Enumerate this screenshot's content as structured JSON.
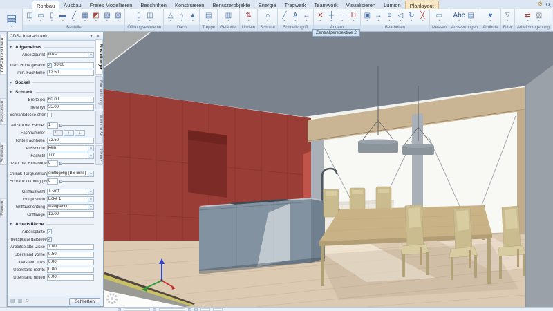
{
  "ribbon": {
    "tabs": [
      {
        "label": "Rohbau",
        "active": true
      },
      {
        "label": "Ausbau"
      },
      {
        "label": "Freies Modellieren"
      },
      {
        "label": "Beschriften"
      },
      {
        "label": "Konstruieren"
      },
      {
        "label": "Benutzerobjekte"
      },
      {
        "label": "Energie"
      },
      {
        "label": "Tragwerk"
      },
      {
        "label": "Teamwork"
      },
      {
        "label": "Visualisieren"
      },
      {
        "label": "Lumion"
      },
      {
        "label": "Planlayout",
        "highlight": true
      }
    ],
    "groups": [
      {
        "label": "Bauteile",
        "icons": [
          {
            "name": "wall-icon",
            "glyph": "◫"
          },
          {
            "name": "ceiling-icon",
            "glyph": "▭"
          },
          {
            "name": "column-icon",
            "glyph": "▯"
          },
          {
            "name": "beam-icon",
            "glyph": "▬"
          },
          {
            "name": "profile-icon",
            "glyph": "╱"
          },
          {
            "name": "mesh-icon",
            "glyph": "▦"
          },
          {
            "name": "import-icon",
            "glyph": "◩",
            "color": "#a8433a"
          },
          {
            "name": "snap-icon",
            "glyph": "▧"
          },
          {
            "name": "tools-icon",
            "glyph": "▨"
          }
        ]
      },
      {
        "label": "Öffnungselemente",
        "icons": [
          {
            "name": "door-icon",
            "glyph": "▯"
          },
          {
            "name": "window-icon",
            "glyph": "◫"
          }
        ]
      },
      {
        "label": "Dach",
        "icons": [
          {
            "name": "roof-icon",
            "glyph": "△"
          },
          {
            "name": "dormer-icon",
            "glyph": "⌂"
          },
          {
            "name": "skylight-icon",
            "glyph": "▲"
          }
        ]
      },
      {
        "label": "Treppe",
        "icons": [
          {
            "name": "stair-icon",
            "glyph": "▤"
          }
        ]
      },
      {
        "label": "Geländer",
        "icons": [
          {
            "name": "railing-icon",
            "glyph": "▥"
          }
        ]
      },
      {
        "label": "Update",
        "icons": [
          {
            "name": "update-icon",
            "glyph": "⇅",
            "color": "#a8433a"
          }
        ]
      },
      {
        "label": "Schnitte",
        "icons": [
          {
            "name": "section-icon",
            "glyph": "∩"
          }
        ]
      },
      {
        "label": "Schnellzugriff",
        "icons": [
          {
            "name": "line-icon",
            "glyph": "╱"
          },
          {
            "name": "text-icon",
            "glyph": "A"
          },
          {
            "name": "dimension-icon",
            "glyph": "↔"
          }
        ]
      },
      {
        "label": "Ändern",
        "icons": [
          {
            "name": "erase-icon",
            "glyph": "✕",
            "color": "#a8433a"
          },
          {
            "name": "divide-icon",
            "glyph": "┼"
          },
          {
            "name": "polyline-icon",
            "glyph": "~"
          },
          {
            "name": "join-icon",
            "glyph": "H",
            "color": "#a8433a"
          }
        ]
      },
      {
        "label": "Bearbeiten",
        "icons": [
          {
            "name": "copy-icon",
            "glyph": "▣"
          },
          {
            "name": "move-icon",
            "glyph": "↔"
          },
          {
            "name": "align-icon",
            "glyph": "≡"
          },
          {
            "name": "mirror-icon",
            "glyph": "◁"
          },
          {
            "name": "rotate-icon",
            "glyph": "↻"
          },
          {
            "name": "stretch-icon",
            "glyph": "╳",
            "color": "#a8433a"
          }
        ]
      },
      {
        "label": "Messen",
        "icons": [
          {
            "name": "measure-icon",
            "glyph": "▭"
          }
        ]
      },
      {
        "label": "Auswertungen",
        "icons": [
          {
            "name": "report-icon",
            "glyph": "Abc",
            "color": "#2f4f7f"
          },
          {
            "name": "list-icon",
            "glyph": "▤"
          }
        ]
      },
      {
        "label": "Attribute",
        "icons": [
          {
            "name": "attributes-icon",
            "glyph": "♥",
            "color": "#3f6fb5"
          }
        ]
      },
      {
        "label": "Filter",
        "icons": [
          {
            "name": "filter-icon",
            "glyph": "∇",
            "color": "#8a97a6"
          }
        ]
      },
      {
        "label": "Arbeitsumgebung",
        "icons": [
          {
            "name": "workspace-icon",
            "glyph": "⇄",
            "color": "#a8433a"
          },
          {
            "name": "layout-icon",
            "glyph": "▧",
            "color": "#7c8795"
          }
        ]
      }
    ]
  },
  "left_tabs": [
    "CDS-Unterschrank",
    "Assistenten",
    "Bibliothek",
    "Ebenen"
  ],
  "viewport": {
    "tab_label": "Zentralperspektive 2"
  },
  "panel": {
    "title": "CDS-Unterschrank",
    "side_tabs": [
      "Einstellungen",
      "Formatierung",
      "Attribute Sc...",
      "Lizenz"
    ],
    "close_label": "Schließen",
    "footer_icons": [
      {
        "name": "save-favorite-icon",
        "glyph": "▤"
      },
      {
        "name": "load-favorite-icon",
        "glyph": "▥"
      },
      {
        "name": "reset-icon",
        "glyph": "↻"
      }
    ],
    "sections": [
      {
        "title": "Allgemeines",
        "collapsed": false,
        "fields": [
          {
            "label": "Absetzpunkt",
            "type": "dropdown",
            "value": "links"
          },
          {
            "label": "max. Höhe gesamt",
            "type": "checkinput",
            "checked": true,
            "value": "90.00",
            "gap": true
          },
          {
            "label": "min. Fachhöhe",
            "type": "input",
            "value": "12.50"
          }
        ]
      },
      {
        "title": "Sockel",
        "collapsed": true,
        "fields": []
      },
      {
        "title": "Schrank",
        "collapsed": false,
        "fields": [
          {
            "label": "Breite (x)",
            "type": "input",
            "value": "60.00"
          },
          {
            "label": "Tiefe (y)",
            "type": "input",
            "value": "55.00"
          },
          {
            "label": "Schrankdecke offen",
            "type": "checkbox",
            "checked": false
          },
          {
            "label": "Anzahl der Fächer",
            "type": "numslider",
            "value": "1",
            "gap": true
          },
          {
            "label": "Fachnummer",
            "type": "spinner",
            "value": "1"
          },
          {
            "label": "lichte Fachhöhe",
            "type": "input",
            "value": "72.50"
          },
          {
            "label": "Ausschnitt",
            "type": "dropdown",
            "value": "kein"
          },
          {
            "label": "Fachstil",
            "type": "dropdown",
            "value": "Tür"
          },
          {
            "label": "nzahl der Extraböden",
            "type": "numslider",
            "value": "0"
          },
          {
            "label": "chrank Türgestaltung",
            "type": "dropdown",
            "value": "einflügelig (BS links)",
            "gap": true
          },
          {
            "label": "Schrank Öffnung (%)",
            "type": "numslider",
            "value": "0"
          },
          {
            "label": "Griffauswahl",
            "type": "dropdown",
            "value": "T-Griff",
            "gap": true
          },
          {
            "label": "Griffposition",
            "type": "dropdown",
            "value": "Ecke 1"
          },
          {
            "label": "Griffausrichtung",
            "type": "dropdown",
            "value": "waagrecht"
          },
          {
            "label": "Grifflänge",
            "type": "input",
            "value": "12.00"
          }
        ]
      },
      {
        "title": "Arbeitsfläche",
        "collapsed": false,
        "fields": [
          {
            "label": "Arbeitsplatte",
            "type": "checkbox",
            "checked": true
          },
          {
            "label": "rbeitsplatte darstellen",
            "type": "checkbox",
            "checked": true
          },
          {
            "label": "Arbeitsplatte Dicke",
            "type": "input",
            "value": "1.00"
          },
          {
            "label": "Überstand vorne",
            "type": "input",
            "value": "0.50"
          },
          {
            "label": "Überstand links",
            "type": "input",
            "value": "0.00"
          },
          {
            "label": "Überstand rechts",
            "type": "input",
            "value": "0.00"
          },
          {
            "label": "Überstand hinten",
            "type": "input",
            "value": "0.00"
          }
        ]
      }
    ]
  },
  "ui": {
    "dropdown_arrow": "▾",
    "section_expanded": "▾",
    "section_collapsed": "▸",
    "check": "✓",
    "close": "✕",
    "pin": "▾",
    "app_icon": "▤",
    "gear": "⚙",
    "spinner_up": "↑",
    "spinner_down": "↓"
  },
  "scene": {
    "description": "3D perspective of kitchen with red cabinet wall, island, dining table and window front",
    "colors": {
      "ceiling": "#7a838d",
      "red_wall": "#9a3d36",
      "red_wall_dark": "#7c2b26",
      "red_wall_bright": "#c0544a",
      "lintel": "#c9b493",
      "glass": "#f8f8f5",
      "mullion": "#aab0b8",
      "wood_frame": "#c1ad8c",
      "right_wall": "#9aa1a8",
      "island_front": "#8292a0",
      "island_side": "#70808e",
      "island_top": "#bcc3ca",
      "cooktop": "#3f4a55",
      "cabinet_white": "#efebe1",
      "table": "#c8b286",
      "table_dark": "#b29d74",
      "chair": "#cabc8e",
      "seat": "#d8cda2",
      "leg": "#b1a176",
      "floor": "#dccab3",
      "plank": "#c9b69d",
      "slab_concrete": "#9b9b96",
      "slab_insulation": "#c9c163",
      "slab_dark": "#51493f",
      "outside": "#fcfcfb",
      "lamp": "#8b939b",
      "lamp_top": "#99a1aa",
      "axis_x": "#cc2a2a",
      "axis_y": "#2f9e3a",
      "axis_z": "#2b46c8",
      "corner_concrete": "#a6a9a7"
    }
  }
}
